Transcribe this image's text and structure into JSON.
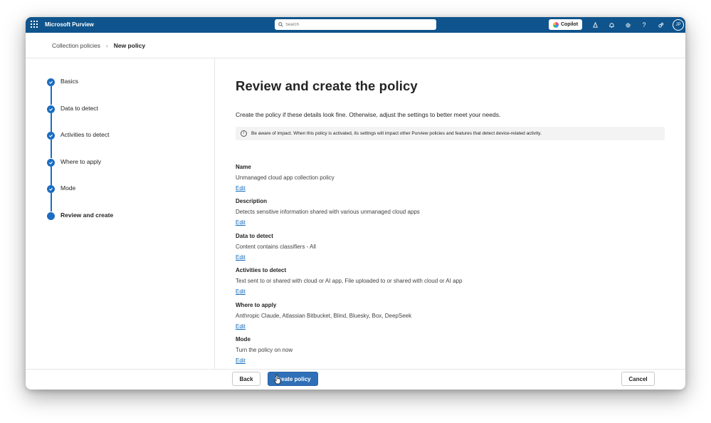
{
  "app": {
    "title": "Microsoft Purview"
  },
  "topbar": {
    "search_placeholder": "Search",
    "copilot_label": "Copilot",
    "avatar_initials": "JP"
  },
  "breadcrumb": {
    "parent": "Collection policies",
    "current": "New policy"
  },
  "steps": [
    {
      "label": "Basics",
      "state": "done"
    },
    {
      "label": "Data to detect",
      "state": "done"
    },
    {
      "label": "Activities to detect",
      "state": "done"
    },
    {
      "label": "Where to apply",
      "state": "done"
    },
    {
      "label": "Mode",
      "state": "done"
    },
    {
      "label": "Review and create",
      "state": "active"
    }
  ],
  "main": {
    "title": "Review and create the policy",
    "intro": "Create the policy if these details look fine. Otherwise, adjust the settings to better meet your needs.",
    "notice": "Be aware of impact. When this policy is activated, its settings will impact other Purview policies and features that detect device-related activity.",
    "sections": [
      {
        "heading": "Name",
        "value": "Unmanaged cloud app collection policy",
        "edit": "Edit"
      },
      {
        "heading": "Description",
        "value": "Detects sensitive information shared with various unmanaged cloud apps",
        "edit": "Edit"
      },
      {
        "heading": "Data to detect",
        "value": "Content contains classifiers - All",
        "edit": "Edit"
      },
      {
        "heading": "Activities to detect",
        "value": "Text sent to or shared with cloud or AI app, File uploaded to or shared with cloud or AI app",
        "edit": "Edit"
      },
      {
        "heading": "Where to apply",
        "value": "Anthropic Claude, Atlassian Bitbucket, Blind, Bluesky, Box, DeepSeek",
        "edit": "Edit"
      },
      {
        "heading": "Mode",
        "value": "Turn the policy on now",
        "edit": "Edit"
      }
    ]
  },
  "footer": {
    "back_label": "Back",
    "create_label": "Create policy",
    "cancel_label": "Cancel"
  },
  "colors": {
    "topbar": "#0f548c",
    "accent": "#1b6dc1",
    "primary_button": "#2f6fb7",
    "link": "#0f6cbd"
  }
}
